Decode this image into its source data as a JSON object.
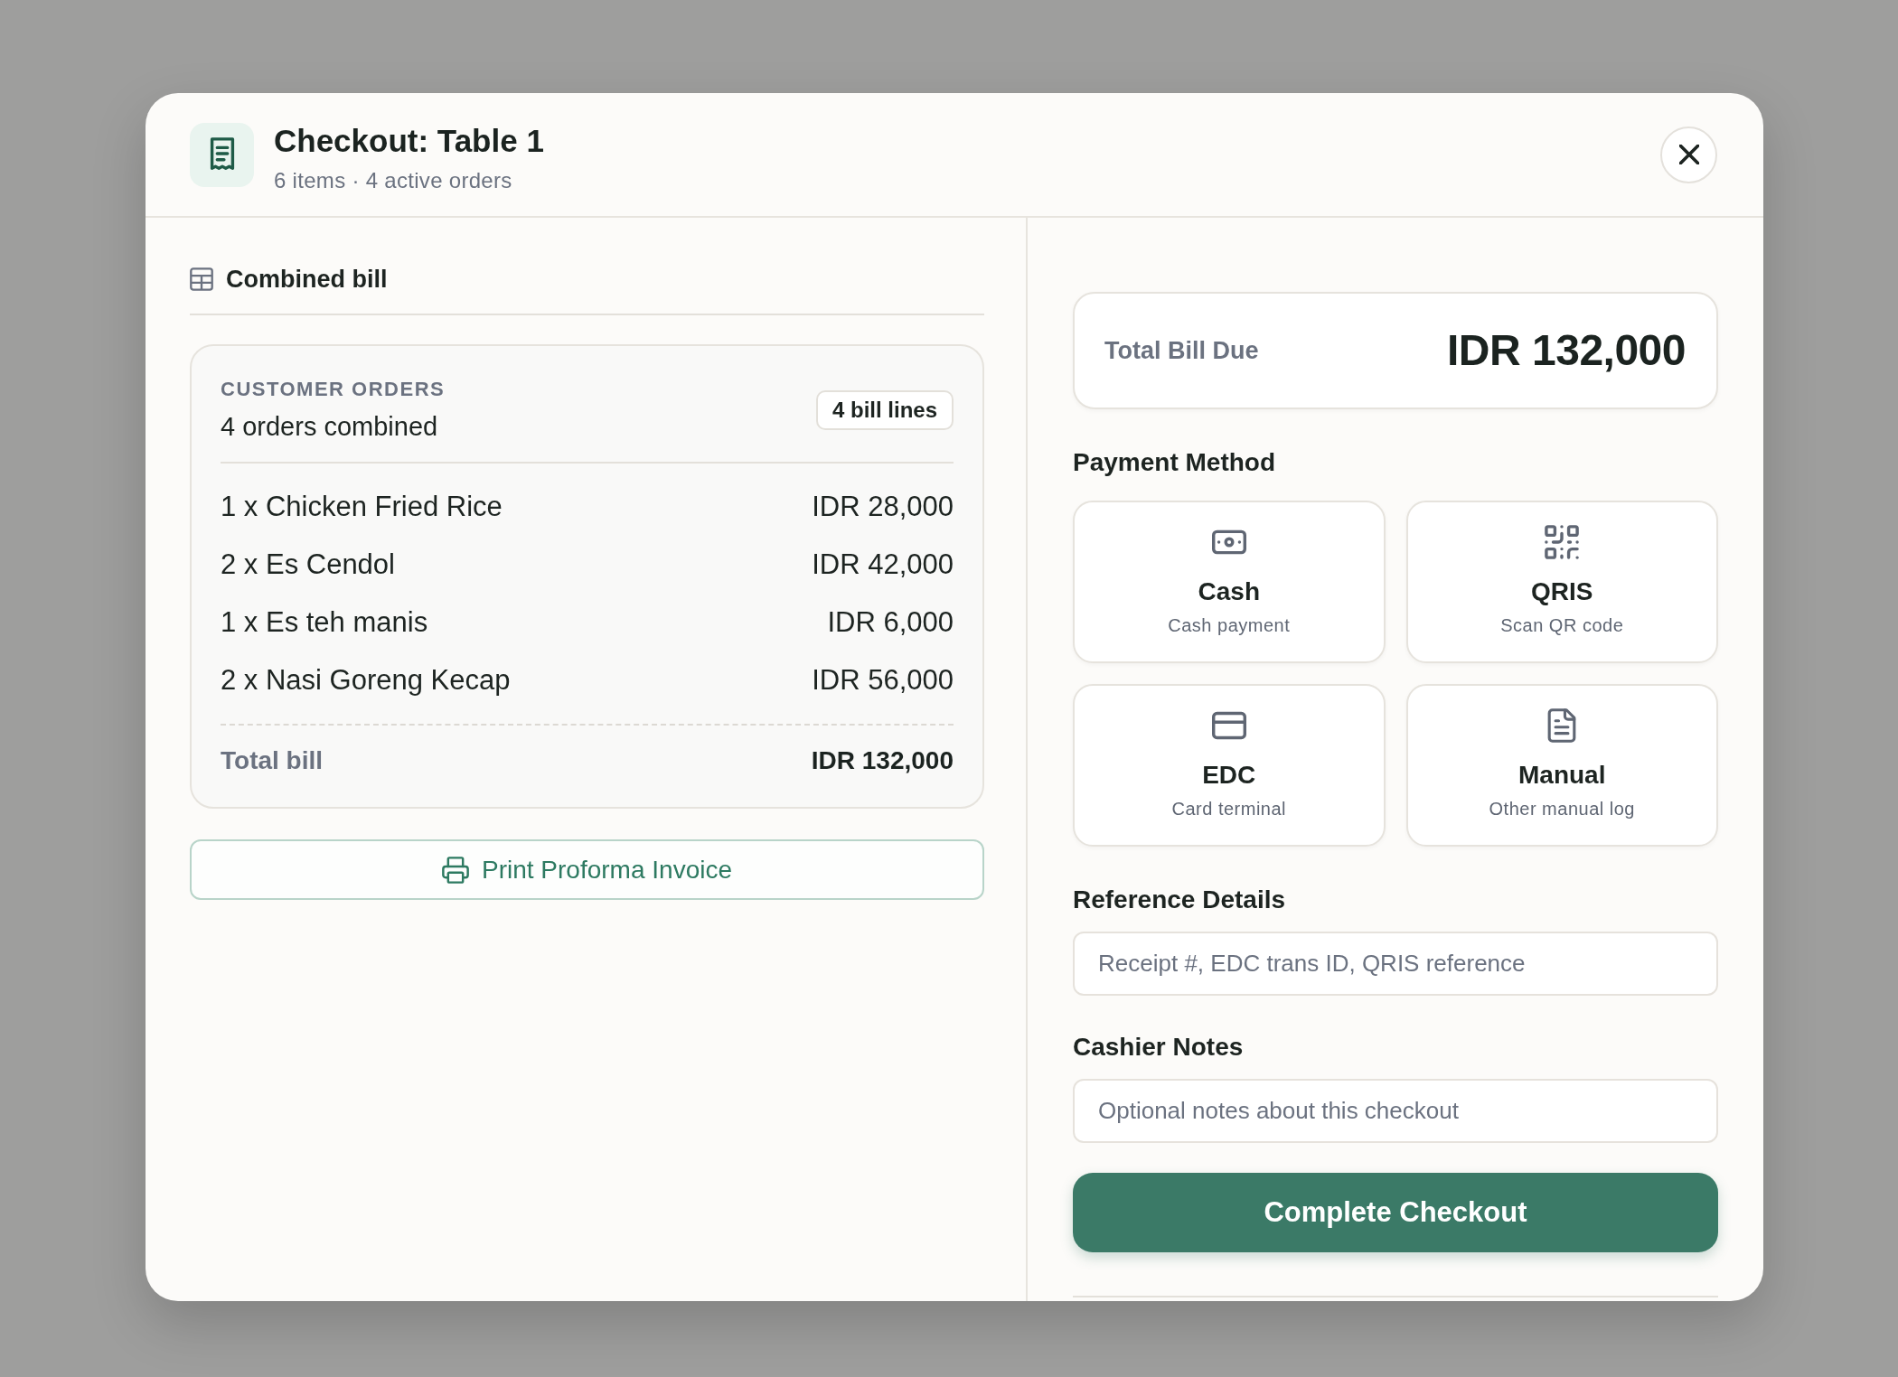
{
  "header": {
    "title": "Checkout: Table 1",
    "subtitle": "6 items · 4 active orders"
  },
  "bill_panel": {
    "heading": "Combined bill",
    "orders_card": {
      "eyebrow": "CUSTOMER ORDERS",
      "summary": "4 orders combined",
      "badge": "4 bill lines",
      "lines": [
        {
          "item": "1 x Chicken Fried Rice",
          "amount": "IDR 28,000"
        },
        {
          "item": "2 x Es Cendol",
          "amount": "IDR 42,000"
        },
        {
          "item": "1 x Es teh manis",
          "amount": "IDR 6,000"
        },
        {
          "item": "2 x Nasi Goreng Kecap",
          "amount": "IDR 56,000"
        }
      ],
      "total_label": "Total bill",
      "total_amount": "IDR 132,000"
    },
    "print_button": "Print Proforma Invoice"
  },
  "payment_panel": {
    "total_due": {
      "label": "Total Bill Due",
      "amount": "IDR 132,000"
    },
    "method_heading": "Payment Method",
    "methods": [
      {
        "kind": "cash",
        "title": "Cash",
        "subtitle": "Cash payment",
        "selected": false
      },
      {
        "kind": "qr",
        "title": "QRIS",
        "subtitle": "Scan QR code",
        "selected": false
      },
      {
        "kind": "card",
        "title": "EDC",
        "subtitle": "Card terminal",
        "selected": false
      },
      {
        "kind": "manual",
        "title": "Manual",
        "subtitle": "Other manual log",
        "selected": false
      }
    ],
    "reference": {
      "label": "Reference Details",
      "placeholder": "Receipt #, EDC trans ID, QRIS reference"
    },
    "notes": {
      "label": "Cashier Notes",
      "placeholder": "Optional notes about this checkout"
    },
    "submit_button": "Complete Checkout"
  }
}
